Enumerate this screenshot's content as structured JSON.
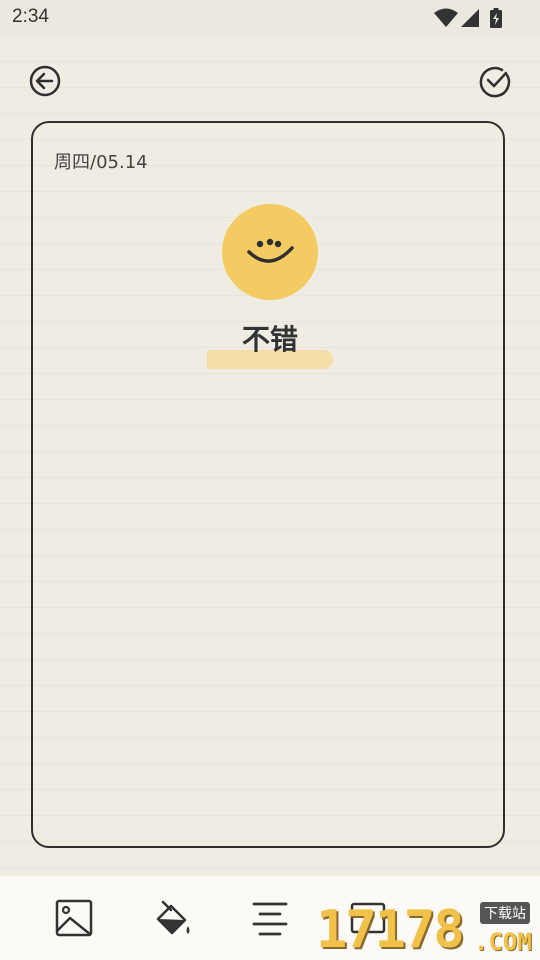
{
  "status_bar": {
    "time": "2:34",
    "icons": [
      "wifi-icon",
      "signal-icon",
      "battery-icon"
    ]
  },
  "header": {
    "back_icon": "back-arrow-icon",
    "confirm_icon": "check-circle-icon"
  },
  "entry": {
    "date": "周四/05.14",
    "mood_icon": "smile-face-icon",
    "mood_color": "#f3cb62",
    "mood_label": "不错"
  },
  "toolbar": {
    "items": [
      "image-icon",
      "paint-bucket-icon",
      "align-center-icon",
      "text-frame-icon"
    ]
  },
  "watermark": {
    "number": "17178",
    "domain": ".COM",
    "tag": "下载站"
  }
}
